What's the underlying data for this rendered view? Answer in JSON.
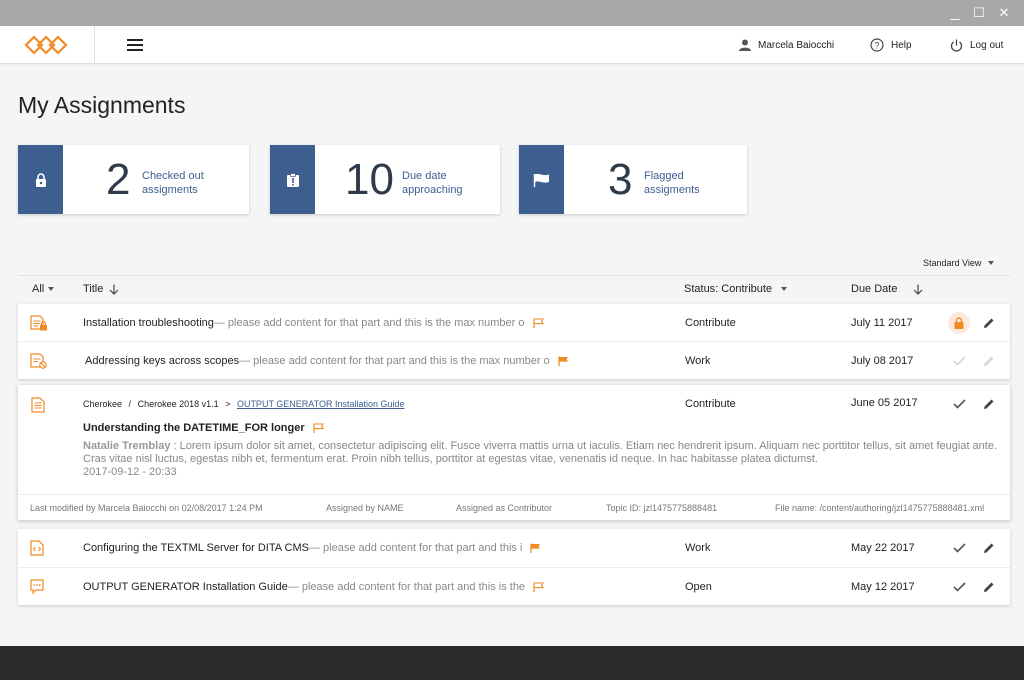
{
  "window": {
    "minimize": "_",
    "maximize": "☐",
    "close": "✕"
  },
  "header": {
    "user_name": "Marcela Baiocchi",
    "help_label": "Help",
    "logout_label": "Log out"
  },
  "page": {
    "title": "My Assignments"
  },
  "stats": [
    {
      "value": "2",
      "label_line1": "Checked out",
      "label_line2": "assigments",
      "icon": "lock-icon"
    },
    {
      "value": "10",
      "label_line1": "Due date",
      "label_line2": "approaching",
      "icon": "alert-clipboard-icon"
    },
    {
      "value": "3",
      "label_line1": "Flagged",
      "label_line2": "assigments",
      "icon": "flag-icon"
    }
  ],
  "view_select": {
    "selected": "Standard View"
  },
  "table": {
    "columns": {
      "all": "All",
      "title": "Title",
      "status": "Status: Contribute",
      "due": "Due Date"
    },
    "rows_top": [
      {
        "title": "Installation troubleshooting",
        "excerpt": " — please add content for that part and this is the max number o",
        "status": "Contribute",
        "due": "July 11 2017",
        "flag": "outline"
      },
      {
        "title": "Addressing keys across scopes",
        "excerpt": " — please add content for that part and this is the max number o",
        "status": "Work",
        "due": "July 08 2017",
        "flag": "filled"
      }
    ],
    "expanded": {
      "crumb1": "Cherokee",
      "sep": "/",
      "crumb2": "Cherokee 2018 v1.1",
      "arrow": ">",
      "crumb_link": "OUTPUT GENERATOR Installation Guide",
      "status": "Contribute",
      "due": "June 05 2017",
      "title": "Understanding the DATETIME_FOR longer",
      "author": "Natalie Tremblay",
      "comment": "  : Lorem ipsum dolor sit amet, consectetur adipiscing elit. Fusce viverra mattis urna ut iaculis. Etiam nec hendrerit ipsum. Aliquam nec porttitor tellus, sit amet feugiat ante. Cras vitae nisl luctus, egestas nibh et, fermentum erat. Proin nibh tellus, porttitor at egestas vitae, venenatis id neque. In hac habitasse platea dictumst.",
      "comment_date": "2017-09-12 - 20:33",
      "meta": {
        "modified": "Last modified by Marcela Baiocchi on 02/08/2017 1:24 PM",
        "assigned_by": "Assigned by NAME",
        "assigned_as": "Assigned as Contributor",
        "topic_id": "Topic ID: jzl1475775888481",
        "file_name": "File name: /content/authoring/jzl1475775888481.xml"
      }
    },
    "rows_bottom": [
      {
        "title": "Configuring the TEXTML Server for DITA CMS",
        "excerpt": " — please add content for that part and this i",
        "status": "Work",
        "due": "May 22 2017",
        "flag": "filled"
      },
      {
        "title": "OUTPUT GENERATOR Installation Guide",
        "excerpt": " — please add content for that part and this is the",
        "status": "Open",
        "due": "May 12 2017",
        "flag": "outline"
      }
    ]
  },
  "colors": {
    "accent": "#3c5f8f",
    "orange": "#f08a24",
    "footer": "#2a2a2a"
  }
}
